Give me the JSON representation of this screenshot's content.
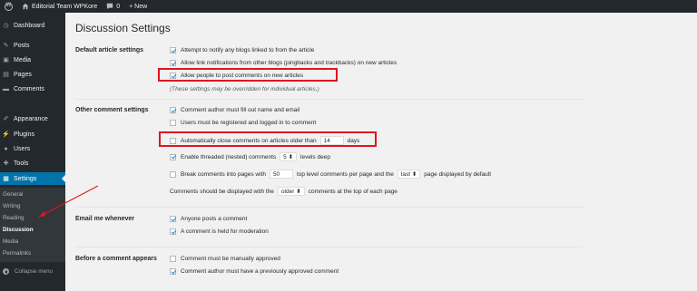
{
  "adminbar": {
    "site_name": "Editorial Team WPKore",
    "comments_count": "0",
    "new_label": "+ New"
  },
  "sidebar": {
    "items": [
      {
        "label": "Dashboard",
        "icon": "dashboard-icon"
      },
      {
        "label": "Posts",
        "icon": "pin-icon"
      },
      {
        "label": "Media",
        "icon": "media-icon"
      },
      {
        "label": "Pages",
        "icon": "pages-icon"
      },
      {
        "label": "Comments",
        "icon": "comment-icon"
      },
      {
        "label": "Appearance",
        "icon": "brush-icon"
      },
      {
        "label": "Plugins",
        "icon": "plugin-icon"
      },
      {
        "label": "Users",
        "icon": "users-icon"
      },
      {
        "label": "Tools",
        "icon": "wrench-icon"
      },
      {
        "label": "Settings",
        "icon": "settings-icon"
      }
    ],
    "submenu": [
      "General",
      "Writing",
      "Reading",
      "Discussion",
      "Media",
      "Permalinks"
    ],
    "collapse_label": "Collapse menu"
  },
  "page": {
    "title": "Discussion Settings"
  },
  "sections": {
    "default_article": {
      "label": "Default article settings",
      "opt1": "Attempt to notify any blogs linked to from the article",
      "opt2": "Allow link notifications from other blogs (pingbacks and trackbacks) on new articles",
      "opt3": "Allow people to post comments on new articles",
      "note": "(These settings may be overridden for individual articles.)"
    },
    "other_comment": {
      "label": "Other comment settings",
      "opt1": "Comment author must fill out name and email",
      "opt2": "Users must be registered and logged in to comment",
      "opt3_prefix": "Automatically close comments on articles older than",
      "opt3_value": "14",
      "opt3_suffix": "days",
      "opt4_prefix": "Enable threaded (nested) comments",
      "opt4_value": "5",
      "opt4_suffix": "levels deep",
      "opt5_prefix": "Break comments into pages with",
      "opt5_value": "50",
      "opt5_middle": "top level comments per page and the",
      "opt5_select": "last",
      "opt5_suffix": "page displayed by default",
      "display_prefix": "Comments should be displayed with the",
      "display_select": "older",
      "display_suffix": "comments at the top of each page"
    },
    "email_me": {
      "label": "Email me whenever",
      "opt1": "Anyone posts a comment",
      "opt2": "A comment is held for moderation"
    },
    "before_comment": {
      "label": "Before a comment appears",
      "opt1": "Comment must be manually approved",
      "opt2": "Comment author must have a previously approved comment"
    }
  },
  "colors": {
    "admin_dark": "#23282d",
    "accent_blue": "#0073aa",
    "highlight_red": "#e0141e"
  }
}
